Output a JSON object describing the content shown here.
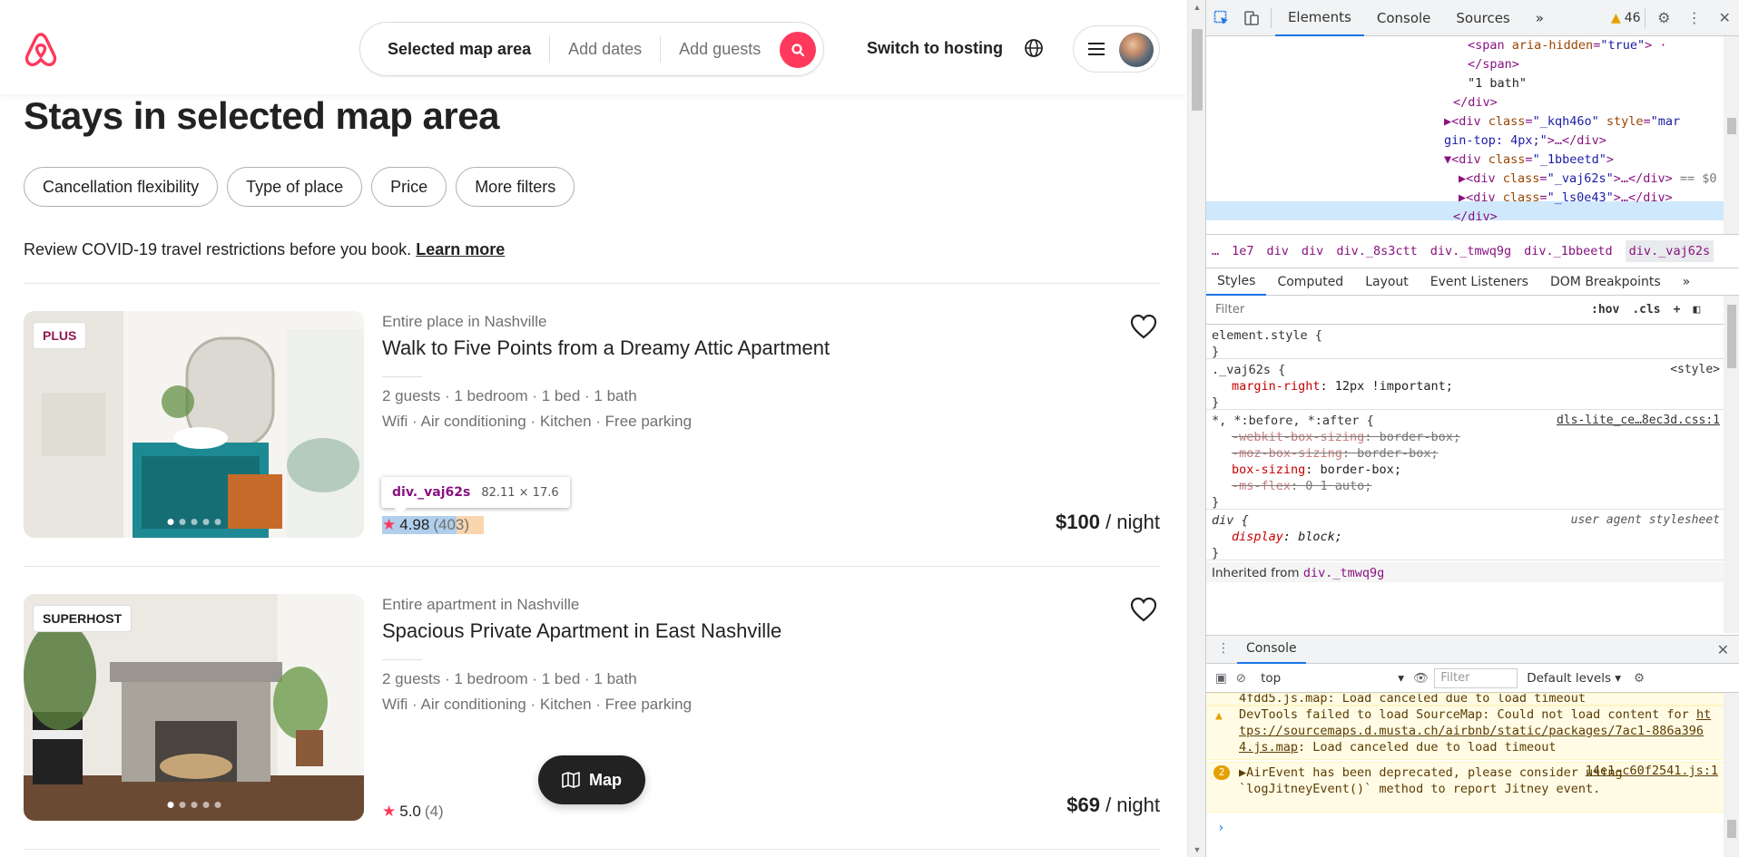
{
  "header": {
    "search_location": "Selected map area",
    "search_dates": "Add dates",
    "search_guests": "Add guests",
    "host_link": "Switch to hosting"
  },
  "page_title": "Stays in selected map area",
  "filters": [
    "Cancellation flexibility",
    "Type of place",
    "Price",
    "More filters"
  ],
  "covid": {
    "text": "Review COVID-19 travel restrictions before you book.",
    "link": "Learn more"
  },
  "listings": [
    {
      "badge": "PLUS",
      "type": "Entire place in Nashville",
      "name": "Walk to Five Points from a Dreamy Attic Apartment",
      "guests": "2 guests · 1 bedroom · 1 bed · 1 bath",
      "amenities": "Wifi · Air conditioning · Kitchen · Free parking",
      "rating": "4.98",
      "reviews": "(403)",
      "price": "$100",
      "price_unit": "/ night"
    },
    {
      "badge": "SUPERHOST",
      "type": "Entire apartment in Nashville",
      "name": "Spacious Private Apartment in East Nashville",
      "guests": "2 guests · 1 bedroom · 1 bed · 1 bath",
      "amenities": "Wifi · Air conditioning · Kitchen · Free parking",
      "rating": "5.0",
      "reviews": "(4)",
      "price": "$69",
      "price_unit": "/ night"
    }
  ],
  "tooltip": {
    "tag": "div._vaj62s",
    "size": "82.11 × 17.6"
  },
  "map_button": "Map",
  "devtools": {
    "tabs": [
      "Elements",
      "Console",
      "Sources",
      "»"
    ],
    "warning_count": "46",
    "dom": {
      "l1_tag_open": "<span ",
      "l1_attr": "aria-hidden",
      "l1_val": "\"true\"",
      "l1_close": "> ·",
      "l2": "</span>",
      "l3": "\"1 bath\"",
      "l4": "</div>",
      "l5_open": "<div ",
      "l5_attr": "class",
      "l5_val": "\"_kqh46o\"",
      "l5_attr2": " style",
      "l5_val2": "\"mar",
      "l6_val": "gin-top: 4px;\"",
      "l6_rest": ">…</div>",
      "l7_open": "<div ",
      "l7_attr": "class",
      "l7_val": "\"_1bbeetd\"",
      "l7_close": ">",
      "l8_open": "<div ",
      "l8_attr": "class",
      "l8_val": "\"_vaj62s\"",
      "l8_close": ">…</div>",
      "l8_eq": " == $0",
      "l9_open": "<div ",
      "l9_attr": "class",
      "l9_val": "\"_ls0e43\"",
      "l9_close": ">…</div>",
      "l10": "</div>"
    },
    "breadcrumbs": [
      "…",
      "1e7",
      "div",
      "div",
      "div._8s3ctt",
      "div._tmwq9g",
      "div._1bbeetd",
      "div._vaj62s"
    ],
    "sub_tabs": [
      "Styles",
      "Computed",
      "Layout",
      "Event Listeners",
      "DOM Breakpoints",
      "»"
    ],
    "filter_placeholder": "Filter",
    "hov": ":hov",
    "cls": ".cls",
    "styles": {
      "element_style": "element.style {",
      "close": "}",
      "r1_sel": "._vaj62s {",
      "r1_src": "<style>",
      "r1_prop": "margin-right",
      "r1_val": ": 12px !important;",
      "r2_sel": "*, *:before, *:after {",
      "r2_src": "dls-lite_ce…8ec3d.css:1",
      "r2_p1": "-webkit-box-sizing",
      "r2_v1": ": border-box;",
      "r2_p2": "-moz-box-sizing",
      "r2_v2": ": border-box;",
      "r2_p3": "box-sizing",
      "r2_v3": ": border-box;",
      "r2_p4": "-ms-flex",
      "r2_v4": ": 0 1 auto;",
      "r3_sel": "div {",
      "r3_src": "user agent stylesheet",
      "r3_prop": "display",
      "r3_val": ": block;",
      "inherited_label": "Inherited from",
      "inherited_from": "div._tmwq9g"
    },
    "drawer_tab": "Console",
    "console_context": "top",
    "console_filter": "Filter",
    "console_levels": "Default levels ▾",
    "console": {
      "m0": "4fdd5.js.map: Load canceled due to load timeout",
      "m1_text": "DevTools failed to load SourceMap: Could not load content for",
      "m1_link": "https://sourcemaps.d.musta.ch/airbnb/static/packages/7ac1-886a3964.js.map",
      "m1_rest": ": Load canceled due to load timeout",
      "m2_count": "2",
      "m2_text": "▶AirEvent has been deprecated, please consider using `logJitneyEvent()` method to report Jitney event.",
      "m2_src": "14e1-c60f2541.js:1"
    }
  },
  "colors": {
    "brand": "#ff385c",
    "text": "#222222",
    "muted": "#717171",
    "devtools_accent": "#1a73e8"
  }
}
